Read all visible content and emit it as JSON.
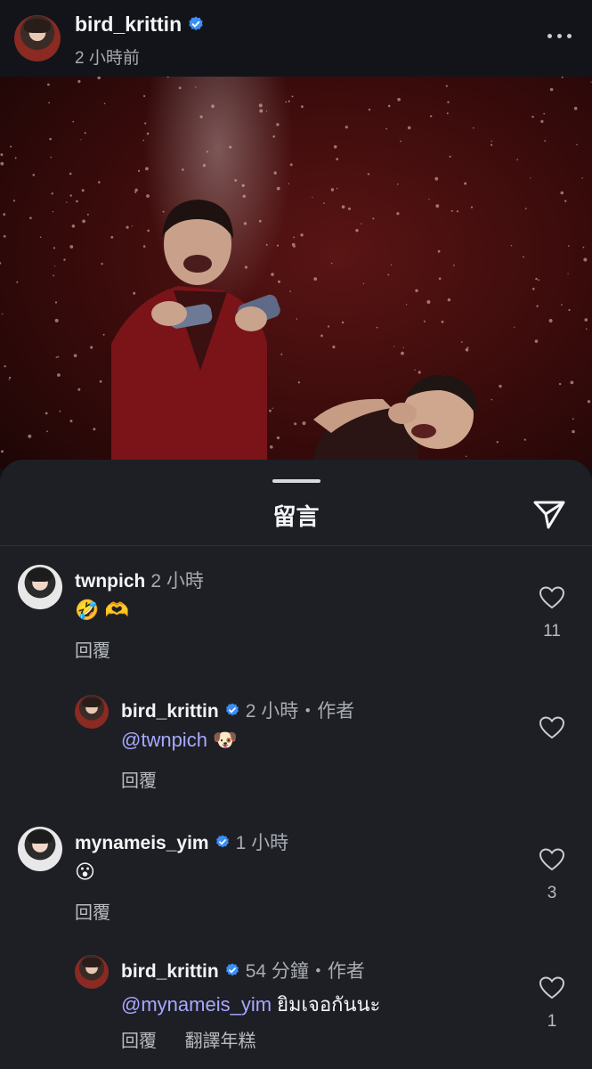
{
  "post": {
    "username": "bird_krittin",
    "time": "2 小時前"
  },
  "sheet": {
    "title": "留言"
  },
  "comments": [
    {
      "username": "twnpich",
      "meta": "2 小時",
      "text": "🤣 🫶",
      "reply_label": "回覆",
      "likes": "11"
    },
    {
      "username": "bird_krittin",
      "meta": "2 小時・作者",
      "mention": "@twnpich",
      "text": " 🐶",
      "reply_label": "回覆",
      "likes": ""
    },
    {
      "username": "mynameis_yim",
      "meta": "1 小時",
      "text": "😮",
      "reply_label": "回覆",
      "likes": "3"
    },
    {
      "username": "bird_krittin",
      "meta": "54 分鐘・作者",
      "mention": "@mynameis_yim",
      "text": " ยิมเจอกันนะ",
      "reply_label": "回覆",
      "translate_label": "翻譯年糕",
      "likes": "1"
    }
  ],
  "colors": {
    "verified": "#3a8ef6",
    "mention": "#a9a7ff",
    "sheet_bg": "#1d1f24"
  }
}
